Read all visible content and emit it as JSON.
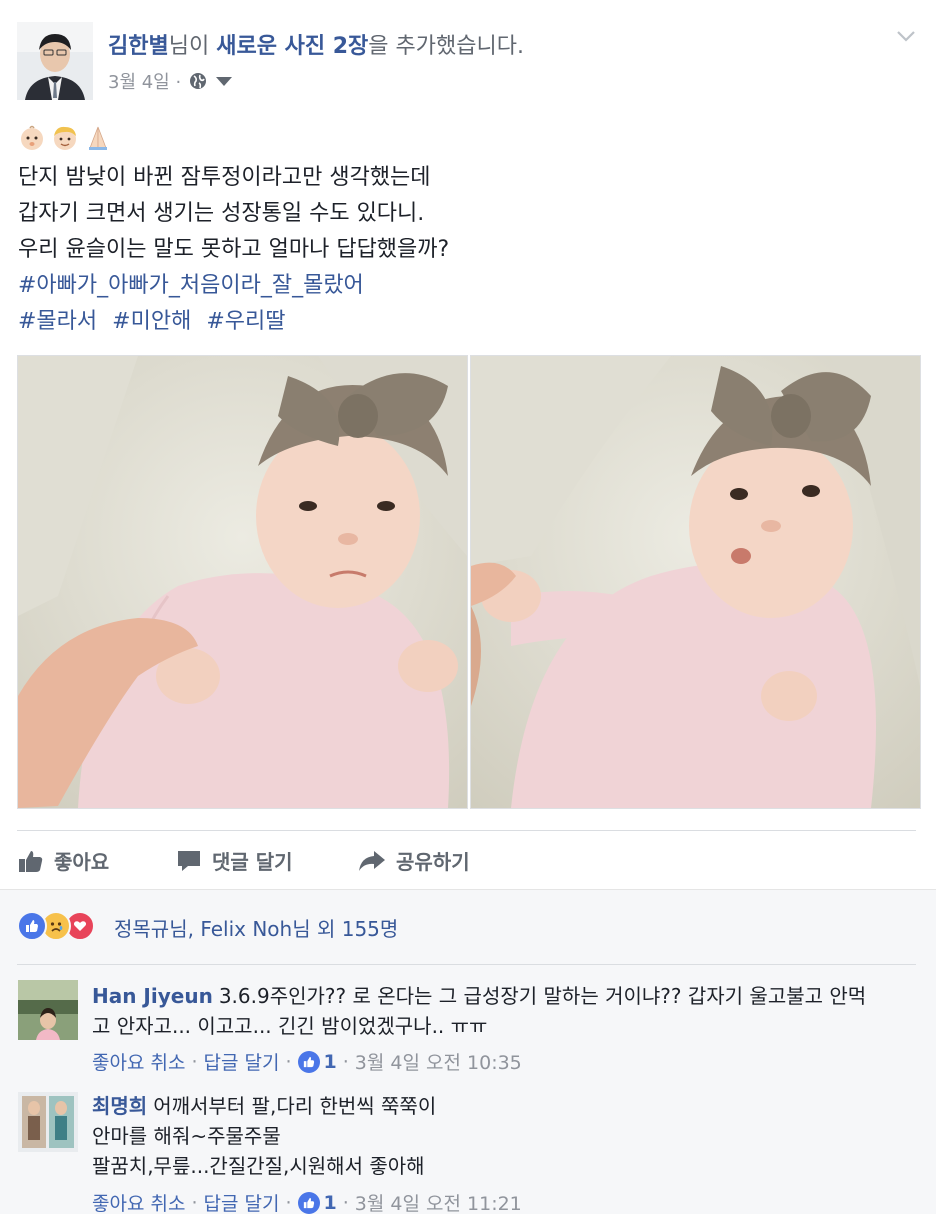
{
  "post": {
    "author": "김한별",
    "header_suffix_1": "님이 ",
    "header_link": "새로운 사진 2장",
    "header_suffix_2": "을 추가했습니다.",
    "date": "3월 4일 ·",
    "privacy_icon": "globe-icon",
    "emojis": [
      "baby-emoji",
      "boy-emoji",
      "folded-hands-emoji"
    ],
    "lines": [
      "단지 밤낮이 바뀐 잠투정이라고만 생각했는데",
      "갑자기 크면서 생기는 성장통일 수도 있다니.",
      "우리 윤슬이는 말도 못하고 얼마나 답답했을까?"
    ],
    "hashtags_line1": "#아빠가_아빠가_처음이라_잘_몰랐어",
    "hashtags_line2": [
      "#몰라서",
      "#미안해",
      "#우리딸"
    ]
  },
  "actions": {
    "like": "좋아요",
    "comment": "댓글 달기",
    "share": "공유하기"
  },
  "reactions": {
    "icons": [
      "like-reaction",
      "sad-reaction",
      "love-reaction"
    ],
    "summary": "정목규님, Felix Noh님 외 155명"
  },
  "comments": [
    {
      "name": "Han Jiyeun",
      "line1": "3.6.9주인가?? 로 온다는 그 급성장기 말하는 거이냐?? 갑자기 울고불고 안먹",
      "line2": "고 안자고... 이고고... 긴긴 밤이었겠구나.. ㅠㅠ",
      "line3": "",
      "like_cancel": "좋아요 취소",
      "reply": "답글 달기",
      "likes": "1",
      "time": "3월 4일 오전 10:35"
    },
    {
      "name": "최명희",
      "line1": "어깨서부터 팔,다리 한번씩 쭉쭉이",
      "line2": "안마를 해줘~주물주물",
      "line3": "팔꿈치,무릎...간질간질,시원해서 좋아해",
      "like_cancel": "좋아요 취소",
      "reply": "답글 달기",
      "likes": "1",
      "time": "3월 4일 오전 11:21"
    }
  ],
  "colors": {
    "link": "#385898",
    "meta": "#90949c",
    "like_blue": "#4a76e8",
    "love_red": "#e8445a",
    "sad_yellow": "#f7c14b"
  }
}
